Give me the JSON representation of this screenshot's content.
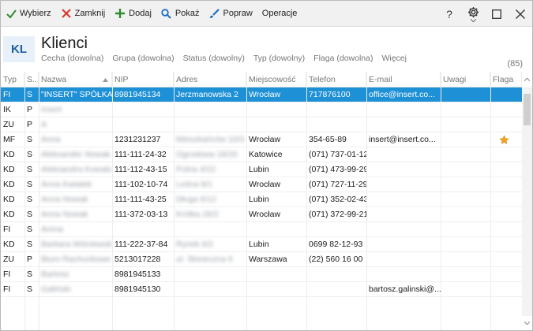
{
  "toolbar": {
    "buttons": [
      {
        "key": "select",
        "label": "Wybierz",
        "icon": "check-icon",
        "color": "#2e8b2e"
      },
      {
        "key": "close",
        "label": "Zamknij",
        "icon": "x-icon",
        "color": "#d9342b"
      },
      {
        "key": "add",
        "label": "Dodaj",
        "icon": "plus-icon",
        "color": "#2e8b2e"
      },
      {
        "key": "show",
        "label": "Pokaż",
        "icon": "magnifier-icon",
        "color": "#1c6fc1"
      },
      {
        "key": "edit",
        "label": "Popraw",
        "icon": "brush-icon",
        "color": "#1c6fc1"
      },
      {
        "key": "ops",
        "label": "Operacje",
        "icon": "",
        "color": ""
      }
    ],
    "help": "?"
  },
  "header": {
    "avatar": "KL",
    "title": "Klienci",
    "filters": [
      "Cecha (dowolna)",
      "Grupa (dowolna)",
      "Status (dowolny)",
      "Typ (dowolny)",
      "Flaga (dowolna)",
      "Więcej"
    ],
    "count": "(85)"
  },
  "columns": [
    {
      "label": "Typ"
    },
    {
      "label": "S..."
    },
    {
      "label": "Nazwa"
    },
    {
      "label": "NIP"
    },
    {
      "label": "Adres"
    },
    {
      "label": "Miejscowość"
    },
    {
      "label": "Telefon"
    },
    {
      "label": "E-mail"
    },
    {
      "label": "Uwagi"
    },
    {
      "label": "Flaga"
    }
  ],
  "rows": [
    {
      "typ": "FI",
      "s": "S",
      "nazwa": "\"INSERT\" SPÓŁKA...",
      "nip": "8981945134",
      "adres": "Jerzmanowska 2",
      "miasto": "Wrocław",
      "tel": "717876100",
      "email": "office@insert.co...",
      "flag": false,
      "selected": true,
      "blur_name": false,
      "blur_addr": false
    },
    {
      "typ": "IK",
      "s": "P",
      "nazwa": "Insert",
      "nip": "",
      "adres": "",
      "miasto": "",
      "tel": "",
      "email": "",
      "flag": false,
      "selected": false,
      "blur_name": true,
      "blur_addr": false
    },
    {
      "typ": "ZU",
      "s": "P",
      "nazwa": "A",
      "nip": "",
      "adres": "",
      "miasto": "",
      "tel": "",
      "email": "",
      "flag": false,
      "selected": false,
      "blur_name": true,
      "blur_addr": false
    },
    {
      "typ": "MF",
      "s": "S",
      "nazwa": "Anna",
      "nip": "1231231237",
      "adres": "Mieszkańców 10/3",
      "miasto": "Wrocław",
      "tel": "354-65-89",
      "email": "insert@insert.co...",
      "flag": true,
      "selected": false,
      "blur_name": true,
      "blur_addr": true
    },
    {
      "typ": "KD",
      "s": "S",
      "nazwa": "Aleksander Nowak",
      "nip": "111-111-24-32",
      "adres": "Ogrodowa 18/20",
      "miasto": "Katowice",
      "tel": "(071) 737-01-12",
      "email": "",
      "flag": false,
      "selected": false,
      "blur_name": true,
      "blur_addr": true
    },
    {
      "typ": "KD",
      "s": "S",
      "nazwa": "Aleksandra Kowalska",
      "nip": "111-112-43-15",
      "adres": "Polna 4/22",
      "miasto": "Lubin",
      "tel": "(071) 473-99-29",
      "email": "",
      "flag": false,
      "selected": false,
      "blur_name": true,
      "blur_addr": true
    },
    {
      "typ": "KD",
      "s": "S",
      "nazwa": "Anna Kwiatek",
      "nip": "111-102-10-74",
      "adres": "Leśna 8/1",
      "miasto": "Wrocław",
      "tel": "(071) 727-11-29",
      "email": "",
      "flag": false,
      "selected": false,
      "blur_name": true,
      "blur_addr": true
    },
    {
      "typ": "KD",
      "s": "S",
      "nazwa": "Anna Nowak",
      "nip": "111-111-43-25",
      "adres": "Długa 6/12",
      "miasto": "Lubin",
      "tel": "(071) 352-02-43",
      "email": "",
      "flag": false,
      "selected": false,
      "blur_name": true,
      "blur_addr": true
    },
    {
      "typ": "KD",
      "s": "S",
      "nazwa": "Anna Nowak",
      "nip": "111-372-03-13",
      "adres": "Krótka 26/2",
      "miasto": "Wrocław",
      "tel": "(071) 372-99-21",
      "email": "",
      "flag": false,
      "selected": false,
      "blur_name": true,
      "blur_addr": true
    },
    {
      "typ": "FI",
      "s": "S",
      "nazwa": "Arena",
      "nip": "",
      "adres": "",
      "miasto": "",
      "tel": "",
      "email": "",
      "flag": false,
      "selected": false,
      "blur_name": true,
      "blur_addr": false
    },
    {
      "typ": "KD",
      "s": "S",
      "nazwa": "Barbara Wiśniewska",
      "nip": "111-222-37-84",
      "adres": "Rynek 6/2",
      "miasto": "Lubin",
      "tel": "0699 82-12-93",
      "email": "",
      "flag": false,
      "selected": false,
      "blur_name": true,
      "blur_addr": true
    },
    {
      "typ": "ZU",
      "s": "P",
      "nazwa": "Biuro Rachunkowe",
      "nip": "5213017228",
      "adres": "ul. Słoneczna 6",
      "miasto": "Warszawa",
      "tel": "(22) 560 16 00",
      "email": "",
      "flag": false,
      "selected": false,
      "blur_name": true,
      "blur_addr": true
    },
    {
      "typ": "FI",
      "s": "S",
      "nazwa": "Bartosz",
      "nip": "8981945133",
      "adres": "",
      "miasto": "",
      "tel": "",
      "email": "",
      "flag": false,
      "selected": false,
      "blur_name": true,
      "blur_addr": false
    },
    {
      "typ": "FI",
      "s": "S",
      "nazwa": "Galiński",
      "nip": "8981945130",
      "adres": "",
      "miasto": "",
      "tel": "",
      "email": "bartosz.galinski@...",
      "flag": false,
      "selected": false,
      "blur_name": true,
      "blur_addr": false
    }
  ],
  "colors": {
    "selection": "#1e90d6",
    "accent": "#1c5fa3",
    "star": "#f2a31a"
  }
}
